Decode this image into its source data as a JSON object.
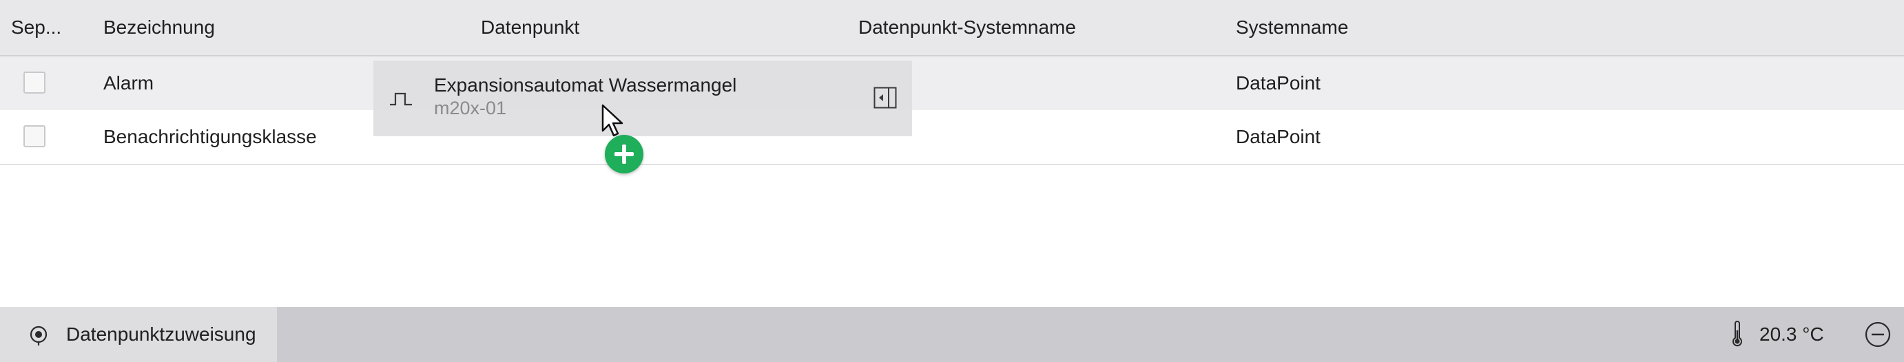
{
  "table": {
    "columns": [
      "Sep...",
      "Bezeichnung",
      "Datenpunkt",
      "Datenpunkt-Systemname",
      "Systemname"
    ],
    "rows": [
      {
        "checked": false,
        "bezeichnung": "Alarm",
        "datenpunkt": "",
        "datenpunkt_systemname": "",
        "systemname": "DataPoint",
        "selected": true
      },
      {
        "checked": false,
        "bezeichnung": "Benachrichtigungsklasse",
        "datenpunkt": "",
        "datenpunkt_systemname": "",
        "systemname": "DataPoint",
        "selected": false
      }
    ]
  },
  "drag": {
    "title": "Expansionsautomat Wassermangel",
    "subtitle": "m20x-01",
    "icon": "pulse-signal-icon",
    "side_icon": "panel-collapse-icon",
    "badge_icon": "plus-icon"
  },
  "footer": {
    "tab_label": "Datenpunktzuweisung",
    "tab_icon": "location-target-icon",
    "temperature": "20.3 °C",
    "temperature_icon": "thermometer-icon",
    "action_icon": "minus-circle-icon"
  },
  "colors": {
    "header_bg": "#e8e8ea",
    "selected_row_bg": "#eeeef0",
    "footer_bg": "#cbcbcf",
    "footer_tab_bg": "#dedee1",
    "badge_green": "#1fae5a"
  }
}
